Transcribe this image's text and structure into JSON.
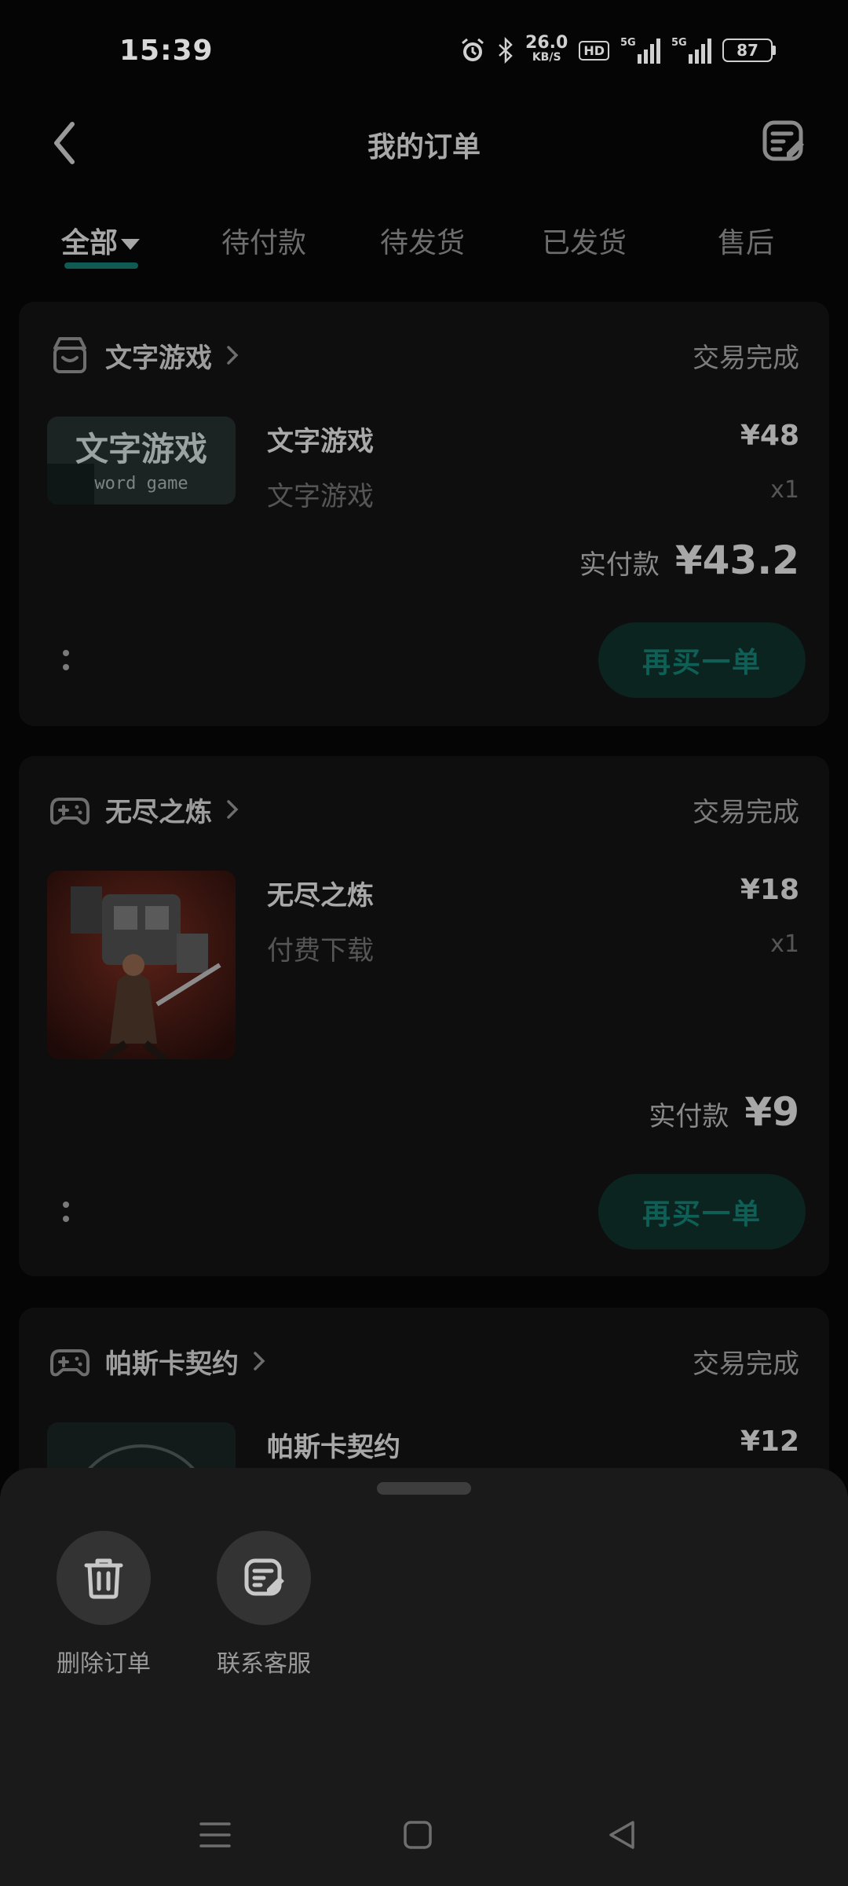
{
  "status_bar": {
    "time": "15:39",
    "net_speed_value": "26.0",
    "net_speed_unit": "KB/S",
    "hd_label": "HD",
    "sim1_label": "5G",
    "sim2_label": "5G",
    "battery": "87"
  },
  "header": {
    "title": "我的订单"
  },
  "tabs": [
    {
      "label": "全部",
      "active": true
    },
    {
      "label": "待付款"
    },
    {
      "label": "待发货"
    },
    {
      "label": "已发货"
    },
    {
      "label": "售后"
    }
  ],
  "orders": [
    {
      "store": "文字游戏",
      "status": "交易完成",
      "product": "文字游戏",
      "subtitle": "文字游戏",
      "price": "¥48",
      "qty": "x1",
      "paid_label": "实付款",
      "paid": "¥43.2",
      "action": "再买一单",
      "thumb_text": "文字游戏",
      "thumb_sub": "word game"
    },
    {
      "store": "无尽之炼",
      "status": "交易完成",
      "product": "无尽之炼",
      "subtitle": "付费下载",
      "price": "¥18",
      "qty": "x1",
      "paid_label": "实付款",
      "paid": "¥9",
      "action": "再买一单"
    },
    {
      "store": "帕斯卡契约",
      "status": "交易完成",
      "product": "帕斯卡契约",
      "price": "¥12"
    }
  ],
  "sheet": {
    "actions": [
      {
        "label": "删除订单",
        "icon": "trash-icon"
      },
      {
        "label": "联系客服",
        "icon": "service-edit-icon"
      }
    ]
  },
  "colors": {
    "accent": "#0f5a52",
    "sheet_bg": "#1a1a1a",
    "card_bg": "#0e0e0e"
  }
}
